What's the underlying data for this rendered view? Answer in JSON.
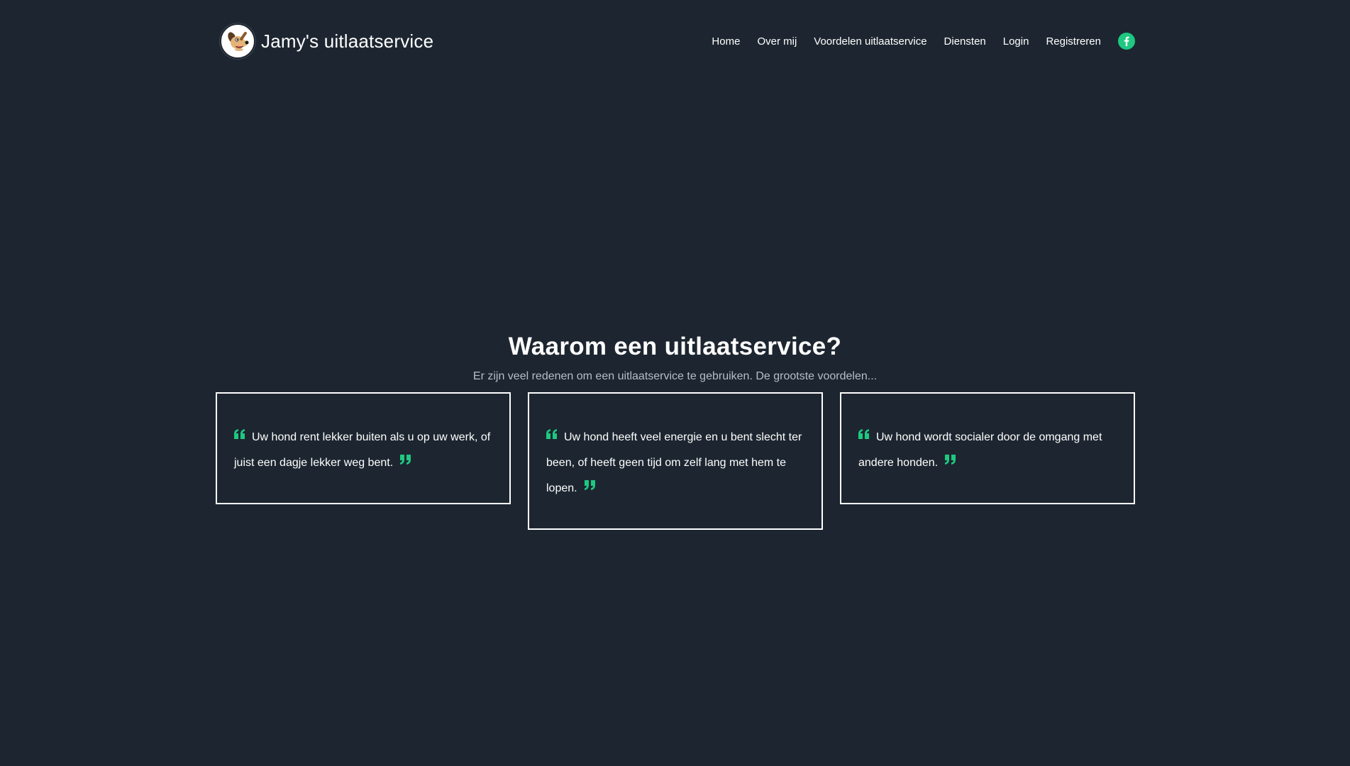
{
  "header": {
    "brand_name": "Jamy's uitlaatservice",
    "logo_icon": "dog-logo",
    "nav": [
      {
        "label": "Home"
      },
      {
        "label": "Over mij"
      },
      {
        "label": "Voordelen uitlaatservice"
      },
      {
        "label": "Diensten"
      },
      {
        "label": "Login"
      },
      {
        "label": "Registreren"
      }
    ],
    "social_icon": "facebook-icon"
  },
  "main": {
    "title": "Waarom een uitlaatservice?",
    "subtitle": "Er zijn veel redenen om een uitlaatservice te gebruiken. De grootste voordelen...",
    "cards": [
      {
        "text": "Uw hond rent lekker buiten als u op uw werk, of juist een dagje lekker weg bent."
      },
      {
        "text": "Uw hond heeft veel energie en u bent slecht ter been, of heeft geen tijd om zelf lang met hem te lopen."
      },
      {
        "text": "Uw hond wordt socialer door de omgang met andere honden."
      }
    ]
  },
  "colors": {
    "background": "#1d2630",
    "accent": "#1ec881",
    "text": "#ffffff",
    "muted_text": "#b6bdc6"
  }
}
